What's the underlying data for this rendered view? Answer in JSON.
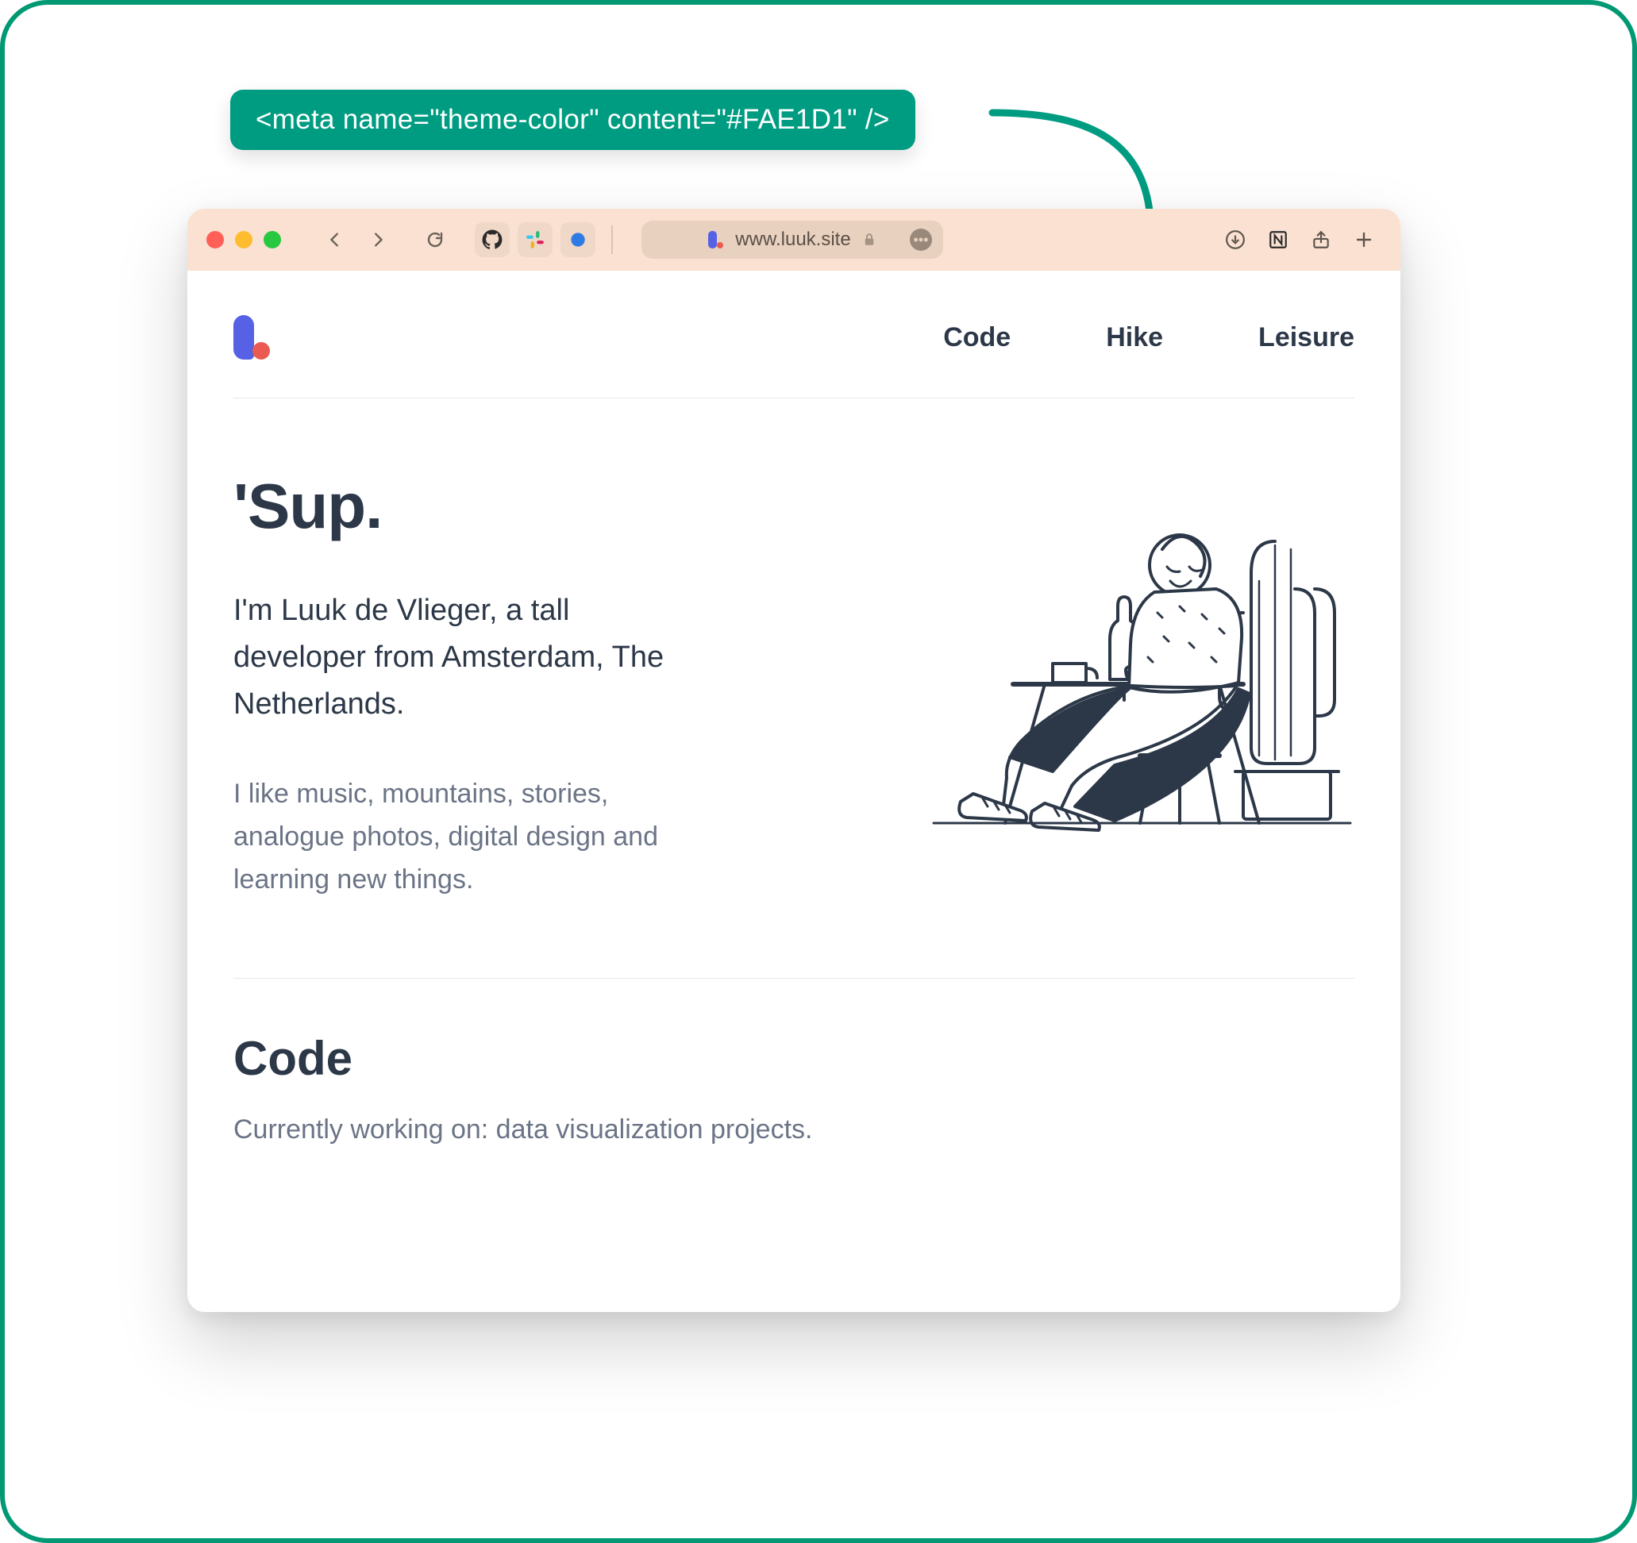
{
  "callout": {
    "code": "<meta name=\"theme-color\" content=\"#FAE1D1\" />"
  },
  "browser": {
    "theme_color": "#FAE1D1",
    "address_url": "www.luuk.site"
  },
  "site": {
    "nav": {
      "code": "Code",
      "hike": "Hike",
      "leisure": "Leisure"
    },
    "hero": {
      "heading": "'Sup.",
      "intro": "I'm Luuk de Vlieger, a tall developer from Amsterdam, The Netherlands.",
      "likes": "I like music, mountains, stories, analogue photos, digital design and learning new things."
    },
    "code_section": {
      "heading": "Code",
      "body": "Currently working on: data visualization projects."
    }
  }
}
